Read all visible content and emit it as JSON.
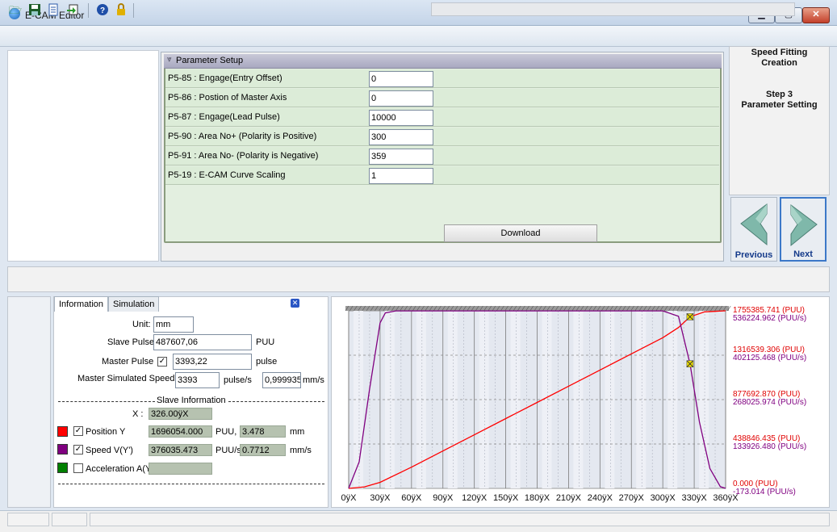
{
  "window": {
    "title": "E-CAM Editor"
  },
  "toolbar": {
    "icons": [
      "open-folder-icon",
      "save-icon",
      "document-icon",
      "export-icon",
      "help-icon",
      "lock-icon"
    ]
  },
  "param_setup": {
    "header": "Parameter Setup",
    "rows": [
      {
        "label": "P5-85 : Engage(Entry Offset)",
        "value": "0"
      },
      {
        "label": "P5-86 : Postion of Master Axis",
        "value": "0"
      },
      {
        "label": "P5-87 : Engage(Lead Pulse)",
        "value": "10000"
      },
      {
        "label": "P5-90 : Area No+ (Polarity is Positive)",
        "value": "300"
      },
      {
        "label": "P5-91 : Area No- (Polarity is Negative)",
        "value": "359"
      },
      {
        "label": "P5-19 : E-CAM Curve Scaling",
        "value": "1"
      }
    ],
    "download_label": "Download"
  },
  "right_panel": {
    "line1": "Speed Fitting",
    "line2": "Creation",
    "line3": "Step 3",
    "line4": "Parameter Setting",
    "previous_label": "Previous",
    "next_label": "Next"
  },
  "info": {
    "tab_info": "Information",
    "tab_sim": "Simulation",
    "unit_label": "Unit:",
    "unit_value": "mm",
    "slave_pulse_label": "Slave Pulse",
    "slave_pulse_value": "487607,06",
    "slave_pulse_unit": "PUU",
    "master_pulse_label": "Master Pulse",
    "master_pulse_value": "3393,22",
    "master_pulse_unit": "pulse",
    "master_speed_label": "Master Simulated Speed",
    "master_speed_value": "3393",
    "master_speed_unit": "pulse/s",
    "master_speed_value2": "0,999935",
    "master_speed_unit2": "mm/s",
    "slave_info_label": "Slave Information",
    "x_label": "X :",
    "x_value": "326.00ÿX",
    "pos_label": "Position Y",
    "pos_value": "1696054.000",
    "pos_unit": "PUU,",
    "pos_value2": "3.478",
    "pos_unit2": "mm",
    "speed_label": "Speed V(Y')",
    "speed_value": "376035.473",
    "speed_unit": "PUU/s,",
    "speed_value2": "0.7712",
    "speed_unit2": "mm/s",
    "acc_label": "Acceleration A(Y",
    "colors": {
      "position": "#ff0000",
      "speed": "#800080",
      "acceleration": "#008000"
    }
  },
  "chart_data": {
    "type": "line",
    "x_ticks": [
      "0ÿX",
      "30ÿX",
      "60ÿX",
      "90ÿX",
      "120ÿX",
      "150ÿX",
      "180ÿX",
      "210ÿX",
      "240ÿX",
      "270ÿX",
      "300ÿX",
      "330ÿX",
      "360ÿX"
    ],
    "xlim": [
      0,
      360
    ],
    "position_labels": [
      "1755385.741  (PUU)",
      "1316539.306  (PUU)",
      "877692.870  (PUU)",
      "438846.435  (PUU)",
      "0.000  (PUU)"
    ],
    "speed_labels": [
      "536224.962  (PUU/s)",
      "402125.468  (PUU/s)",
      "268025.974  (PUU/s)",
      "133926.480  (PUU/s)",
      "-173.014  (PUU/s)"
    ],
    "position_ylim": [
      0,
      1755385.741
    ],
    "speed_ylim": [
      -173.014,
      536224.962
    ],
    "series": [
      {
        "color": "#ff0000",
        "x": [
          0,
          15,
          30,
          60,
          90,
          120,
          150,
          180,
          210,
          240,
          270,
          300,
          315,
          326,
          340,
          360
        ],
        "y": [
          0,
          15000,
          60000,
          210000,
          370000,
          530000,
          690000,
          850000,
          1010000,
          1170000,
          1330000,
          1490000,
          1590000,
          1696054,
          1745000,
          1755385
        ]
      },
      {
        "color": "#800080",
        "x": [
          0,
          10,
          20,
          30,
          35,
          45,
          300,
          315,
          326,
          335,
          345,
          355,
          360
        ],
        "y": [
          0,
          80000,
          300000,
          500000,
          530000,
          536000,
          536000,
          520000,
          376035,
          200000,
          60000,
          5000,
          0
        ]
      }
    ],
    "markers": [
      {
        "x": 326,
        "series": 0
      },
      {
        "x": 326,
        "series": 1
      }
    ],
    "grid": true
  }
}
